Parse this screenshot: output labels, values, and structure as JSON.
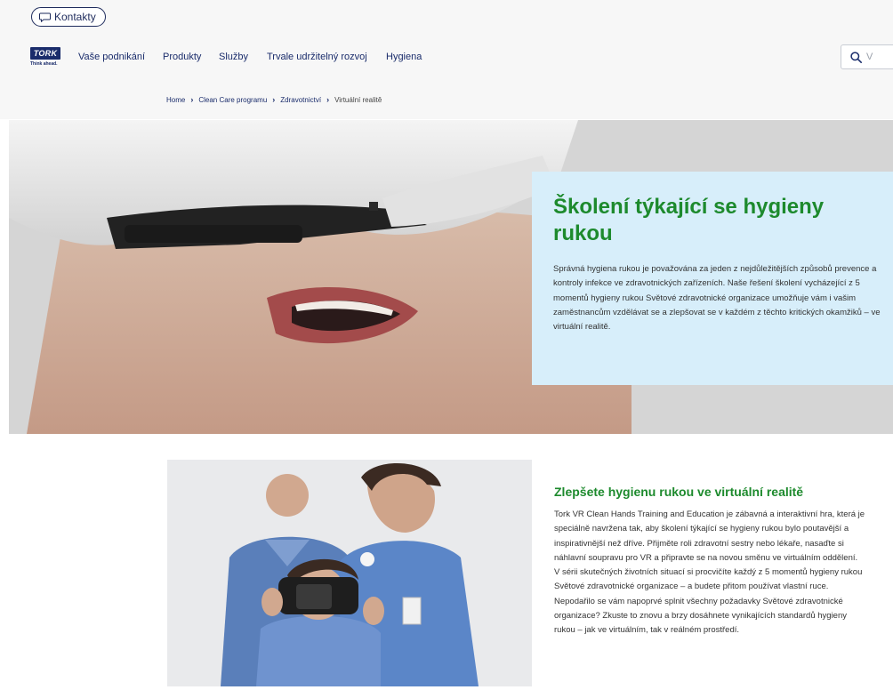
{
  "topbar": {
    "contact_label": "Kontakty",
    "contact_icon": "chat-bubble-icon"
  },
  "logo": {
    "brand": "TORK",
    "tagline": "Think ahead."
  },
  "nav": {
    "items": [
      "Vaše podnikání",
      "Produkty",
      "Služby",
      "Trvale udržitelný rozvoj",
      "Hygiena"
    ],
    "search_placeholder": "V",
    "search_icon": "search-icon"
  },
  "breadcrumb": {
    "items": [
      "Home",
      "Clean Care programu",
      "Zdravotnictví"
    ],
    "current": "Virtuální realitě"
  },
  "hero": {
    "title": "Školení týkající se hygieny rukou",
    "text": "Správná hygiena rukou je považována za jeden z nejdůležitějších způsobů prevence a kontroly infekce ve zdravotnických zařízeních. Naše řešení školení vycházející z 5 momentů hygieny rukou Světové zdravotnické organizace umožňuje vám i vašim zaměstnancům vzdělávat se a zlepšovat se v každém z těchto kritických okamžiků – ve virtuální realitě."
  },
  "section": {
    "title": "Zlepšete hygienu rukou ve virtuální realitě",
    "text": "Tork VR Clean Hands Training and Education je zábavná a interaktivní hra, která je speciálně navržena tak, aby školení týkající se hygieny rukou bylo poutavější a inspirativnější než dříve. Přijměte roli zdravotní sestry nebo lékaře, nasaďte si náhlavní soupravu pro VR a připravte se na novou směnu ve virtuálním oddělení. V sérii skutečných životních situací si procvičíte každý z 5 momentů hygieny rukou Světové zdravotnické organizace – a budete přitom používat vlastní ruce. Nepodařilo se vám napoprvé splnit všechny požadavky Světové zdravotnické organizace? Zkuste to znovu a brzy dosáhnete vynikajících standardů hygieny rukou – jak ve virtuálním, tak v reálném prostředí."
  },
  "colors": {
    "brand_navy": "#1a2c6b",
    "heading_green": "#1d8a2d",
    "panel_blue": "#d7eefa"
  }
}
